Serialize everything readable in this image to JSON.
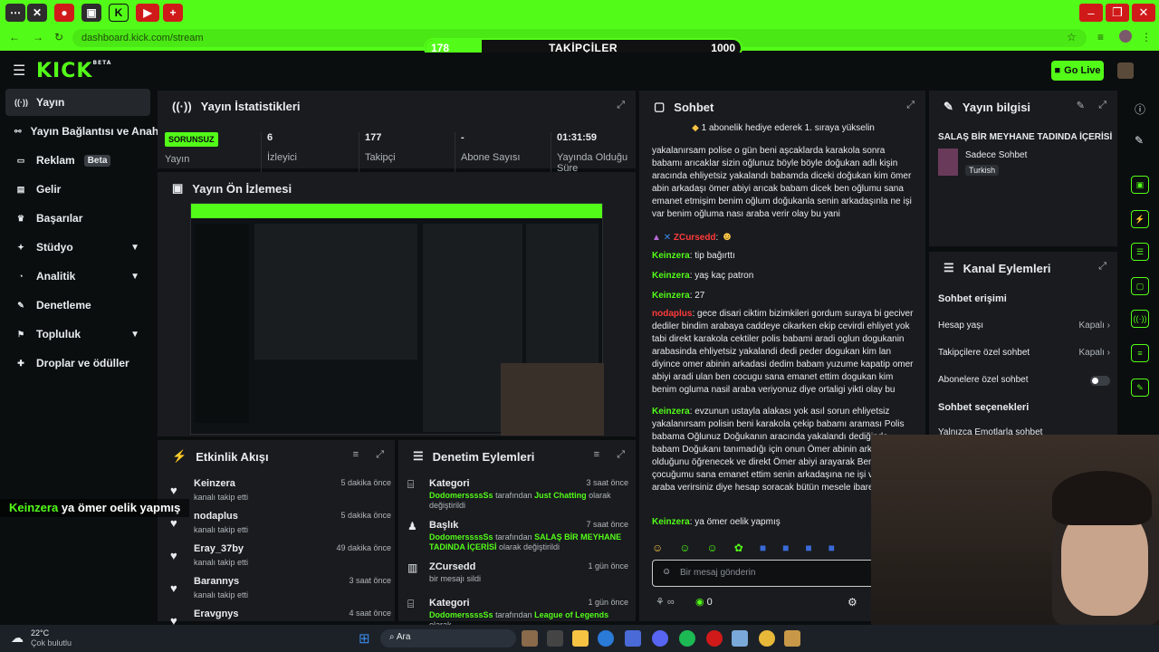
{
  "browser": {
    "url": "dashboard.kick.com/stream",
    "follower_goal": {
      "current": "178",
      "title": "TAKİPÇİLER",
      "goal": "1000",
      "progress": 0.178
    }
  },
  "header": {
    "logo": "KICK",
    "logo_sup": "BETA",
    "go_live_label": "Go Live"
  },
  "sidebar": {
    "items": [
      {
        "label": "Yayın",
        "icon": "stream-icon",
        "active": true
      },
      {
        "label": "Yayın Bağlantısı ve Anahtar",
        "icon": "link-icon"
      },
      {
        "label": "Reklam",
        "icon": "ad-icon",
        "badge": "Beta"
      },
      {
        "label": "Gelir",
        "icon": "revenue-icon"
      },
      {
        "label": "Başarılar",
        "icon": "trophy-icon"
      },
      {
        "label": "Stüdyo",
        "icon": "studio-icon",
        "expandable": true
      },
      {
        "label": "Analitik",
        "icon": "analytics-icon",
        "expandable": true
      },
      {
        "label": "Denetleme",
        "icon": "moderation-icon"
      },
      {
        "label": "Topluluk",
        "icon": "community-icon",
        "expandable": true
      },
      {
        "label": "Droplar ve ödüller",
        "icon": "gift-icon"
      }
    ]
  },
  "stats": {
    "title": "Yayın İstatistikleri",
    "live_badge": "SORUNSUZ",
    "stream_label": "Yayın",
    "items": [
      {
        "value": "6",
        "label": "İzleyici"
      },
      {
        "value": "177",
        "label": "Takipçi"
      },
      {
        "value": "-",
        "label": "Abone Sayısı"
      },
      {
        "value": "01:31:59",
        "label": "Yayında Olduğu Süre"
      }
    ]
  },
  "preview": {
    "title": "Yayın Ön İzlemesi"
  },
  "activity": {
    "title": "Etkinlik Akışı",
    "items": [
      {
        "name": "Keinzera",
        "sub": "kanalı takip etti",
        "time": "5 dakika önce"
      },
      {
        "name": "nodaplus",
        "sub": "kanalı takip etti",
        "time": "5 dakika önce"
      },
      {
        "name": "Eray_37by",
        "sub": "kanalı takip etti",
        "time": "49 dakika önce"
      },
      {
        "name": "Barannys",
        "sub": "kanalı takip etti",
        "time": "3 saat önce"
      },
      {
        "name": "Eravgnys",
        "sub": "",
        "time": "4 saat önce"
      }
    ]
  },
  "moderation": {
    "title": "Denetim Eylemleri",
    "items": [
      {
        "name": "Kategori",
        "user": "DodomerssssSs",
        "mid": "tarafından",
        "target": "Just Chatting",
        "tail": "olarak değiştirildi",
        "time": "3 saat önce",
        "icon": "category-icon"
      },
      {
        "name": "Başlık",
        "user": "DodomerssssSs",
        "mid": "tarafından",
        "target": "SALAŞ BİR MEYHANE TADINDA İÇERİSİ",
        "tail": "olarak değiştirildi",
        "time": "7 saat önce",
        "icon": "title-icon"
      },
      {
        "name": "ZCursedd",
        "user": "",
        "mid": "",
        "target": "",
        "tail": "bir mesajı sildi",
        "time": "1 gün önce",
        "icon": "trash-icon"
      },
      {
        "name": "Kategori",
        "user": "DodomerssssSs",
        "mid": "tarafından",
        "target": "League of Legends",
        "tail": "olarak",
        "time": "1 gün önce",
        "icon": "category-icon"
      }
    ]
  },
  "chat": {
    "title": "Sohbet",
    "pinned": "1 abonelik hediye ederek 1. sıraya yükselin",
    "messages": [
      {
        "user": "",
        "color": "",
        "text": "yakalanırsam polise o gün beni aşcaklarda karakola sonra babamı arıcaklar sizin oğlunuz böyle böyle doğukan adlı kişin aracında ehliyetsiz yakalandı babamda diceki doğukan kim ömer abin arkadaşı ömer abiyi arıcak babam dicek ben oğlumu sana emanet etmişim benim oğlum doğukanla senin arkadaşınla ne işi var benim oğluma nası araba verir olay bu yani"
      },
      {
        "user": "ZCursedd",
        "color": "red",
        "text": ":"
      },
      {
        "user": "Keinzera",
        "color": "green",
        "text": "tip bağırttı"
      },
      {
        "user": "Keinzera",
        "color": "green",
        "text": "yaş kaç patron"
      },
      {
        "user": "Keinzera",
        "color": "green",
        "text": "27"
      },
      {
        "user": "nodaplus",
        "color": "red",
        "text": "gece disari ciktim bizimkileri gordum suraya bi geciver dediler bindim arabaya caddeye cikarken ekip cevirdi ehliyet yok tabi direkt karakola cektiler polis babami aradi oglun dogukanin arabasinda ehliyetsiz yakalandi dedi peder dogukan kim lan diyince omer abinin arkadasi dedim babam yuzume kapatip omer abiyi aradi ulan ben cocugu sana emanet ettim dogukan kim benim ogluma nasil araba veriyonuz diye ortaligi yikti olay bu"
      },
      {
        "user": "Keinzera",
        "color": "green",
        "text": "evzunun ustayla alakası yok asıl sorun ehliyetsiz yakalanırsam polisin beni karakola çekip babamı araması Polis babama Oğlunuz Doğukanın aracında yakalandı dediğinde babam Doğukanı tanımadığı için onun Ömer abinin arkadaşı olduğunu öğrenecek ve direkt Ömer abiyi arayarak Ben çocuğumu sana emanet ettim senin arkadaşına ne işi var nasıl araba verirsiniz diye hesap soracak bütün mesele ibaret"
      },
      {
        "user": "Keinzera",
        "color": "green",
        "text": "ya ömer oelik yapmış"
      }
    ],
    "input_placeholder": "Bir mesaj gönderin",
    "points": "0"
  },
  "stream_info": {
    "title": "Yayın bilgisi",
    "stream_title": "SALAŞ BİR MEYHANE TADINDA İÇERİSİ",
    "category": "Sadece Sohbet",
    "language": "Turkish"
  },
  "channel_actions": {
    "title": "Kanal Eylemleri",
    "chat_access_heading": "Sohbet erişimi",
    "rows": [
      {
        "label": "Hesap yaşı",
        "value": "Kapalı",
        "kind": "link"
      },
      {
        "label": "Takipçilere özel sohbet",
        "value": "Kapalı",
        "kind": "link"
      },
      {
        "label": "Abonelere özel sohbet",
        "value": "",
        "kind": "toggle"
      }
    ],
    "chat_options_heading": "Sohbet seçenekleri",
    "partial_row": "Yalnızca Emotlarla sohbet"
  },
  "overlay": {
    "chat_user": "Keinzera",
    "chat_text": "ya ömer oelik yapmış"
  },
  "taskbar": {
    "temperature": "22°C",
    "weather": "Çok bulutlu",
    "search_label": "Ara"
  },
  "colors": {
    "brand": "#53fc18",
    "panel": "#191b1f",
    "bg": "#0b0e0f",
    "danger": "#ff3b3b"
  }
}
